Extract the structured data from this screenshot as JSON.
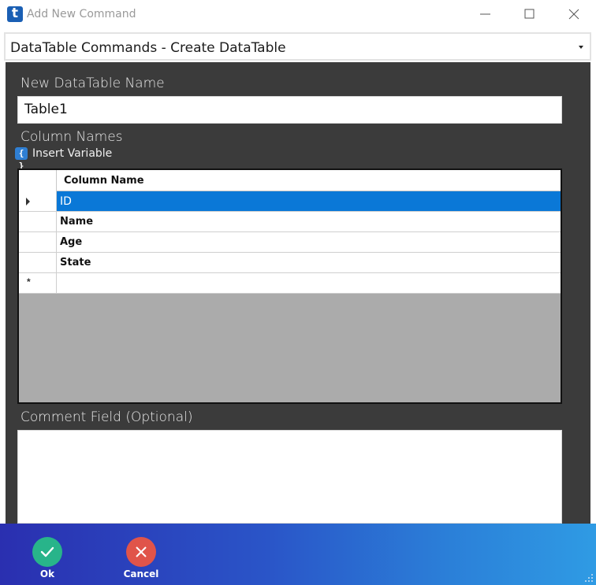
{
  "window": {
    "app_icon_letter": "t",
    "title": "Add New Command"
  },
  "command_selector": {
    "selected": "DataTable Commands - Create DataTable"
  },
  "form": {
    "name_label": "New DataTable Name",
    "name_value": "Table1",
    "columns_label": "Column Names",
    "insert_variable_icon": "{ }",
    "insert_variable_label": "Insert Variable",
    "comment_label": "Comment Field (Optional)",
    "comment_value": ""
  },
  "grid": {
    "column_header": "Column Name",
    "rows": [
      {
        "value": "ID",
        "selected": true
      },
      {
        "value": "Name",
        "selected": false
      },
      {
        "value": "Age",
        "selected": false
      },
      {
        "value": "State",
        "selected": false
      }
    ],
    "new_row_marker": "*"
  },
  "footer": {
    "ok_label": "Ok",
    "cancel_label": "Cancel"
  },
  "colors": {
    "selection": "#0a78d7",
    "panel": "#3b3b3b",
    "ok": "#28b48a",
    "cancel": "#e0544a"
  }
}
